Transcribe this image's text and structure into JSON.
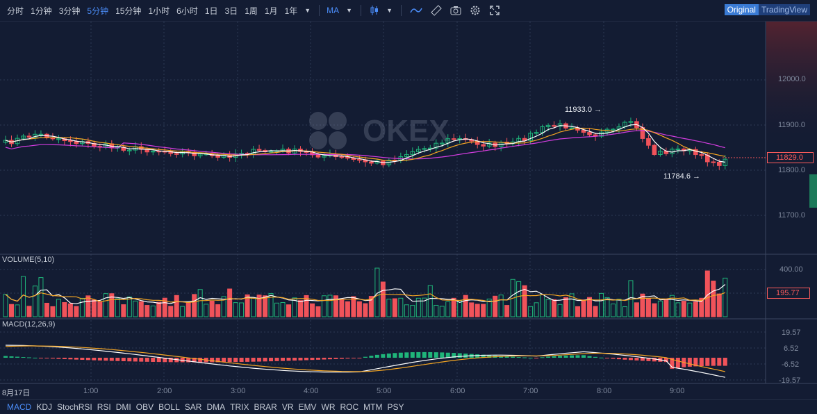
{
  "toolbar": {
    "intervals": [
      {
        "label": "分时",
        "active": false
      },
      {
        "label": "1分钟",
        "active": false
      },
      {
        "label": "3分钟",
        "active": false
      },
      {
        "label": "5分钟",
        "active": true
      },
      {
        "label": "15分钟",
        "active": false
      },
      {
        "label": "1小时",
        "active": false
      },
      {
        "label": "6小时",
        "active": false
      },
      {
        "label": "1日",
        "active": false
      },
      {
        "label": "3日",
        "active": false
      },
      {
        "label": "1周",
        "active": false
      },
      {
        "label": "1月",
        "active": false
      },
      {
        "label": "1年",
        "active": false
      }
    ],
    "indicator": "MA",
    "view_original": "Original",
    "view_tradingview": "TradingView"
  },
  "watermark": "OKEX",
  "main_chart": {
    "price_axis": [
      "12000.0",
      "11900.0",
      "11800.0",
      "11700.0"
    ],
    "current_price": "11829.0",
    "high_annotation": "11933.0 →",
    "low_annotation": "11784.6 →",
    "colors": {
      "up": "#1fb57a",
      "down": "#f0535a",
      "ma_white": "#ffffff",
      "ma_yellow": "#f5a623",
      "ma_magenta": "#d43de0"
    }
  },
  "volume_panel": {
    "title": "VOLUME(5,10)",
    "axis": [
      "400.00"
    ],
    "current_value": "195.77"
  },
  "macd_panel": {
    "title": "MACD(12,26,9)",
    "axis": [
      "19.57",
      "6.52",
      "-6.52",
      "-19.57"
    ]
  },
  "time_axis": [
    "8月17日",
    "1:00",
    "2:00",
    "3:00",
    "4:00",
    "5:00",
    "6:00",
    "7:00",
    "8:00",
    "9:00"
  ],
  "bottom_tabs": [
    {
      "label": "MACD",
      "active": true
    },
    {
      "label": "KDJ",
      "active": false
    },
    {
      "label": "StochRSI",
      "active": false
    },
    {
      "label": "RSI",
      "active": false
    },
    {
      "label": "DMI",
      "active": false
    },
    {
      "label": "OBV",
      "active": false
    },
    {
      "label": "BOLL",
      "active": false
    },
    {
      "label": "SAR",
      "active": false
    },
    {
      "label": "DMA",
      "active": false
    },
    {
      "label": "TRIX",
      "active": false
    },
    {
      "label": "BRAR",
      "active": false
    },
    {
      "label": "VR",
      "active": false
    },
    {
      "label": "EMV",
      "active": false
    },
    {
      "label": "WR",
      "active": false
    },
    {
      "label": "ROC",
      "active": false
    },
    {
      "label": "MTM",
      "active": false
    },
    {
      "label": "PSY",
      "active": false
    }
  ]
}
